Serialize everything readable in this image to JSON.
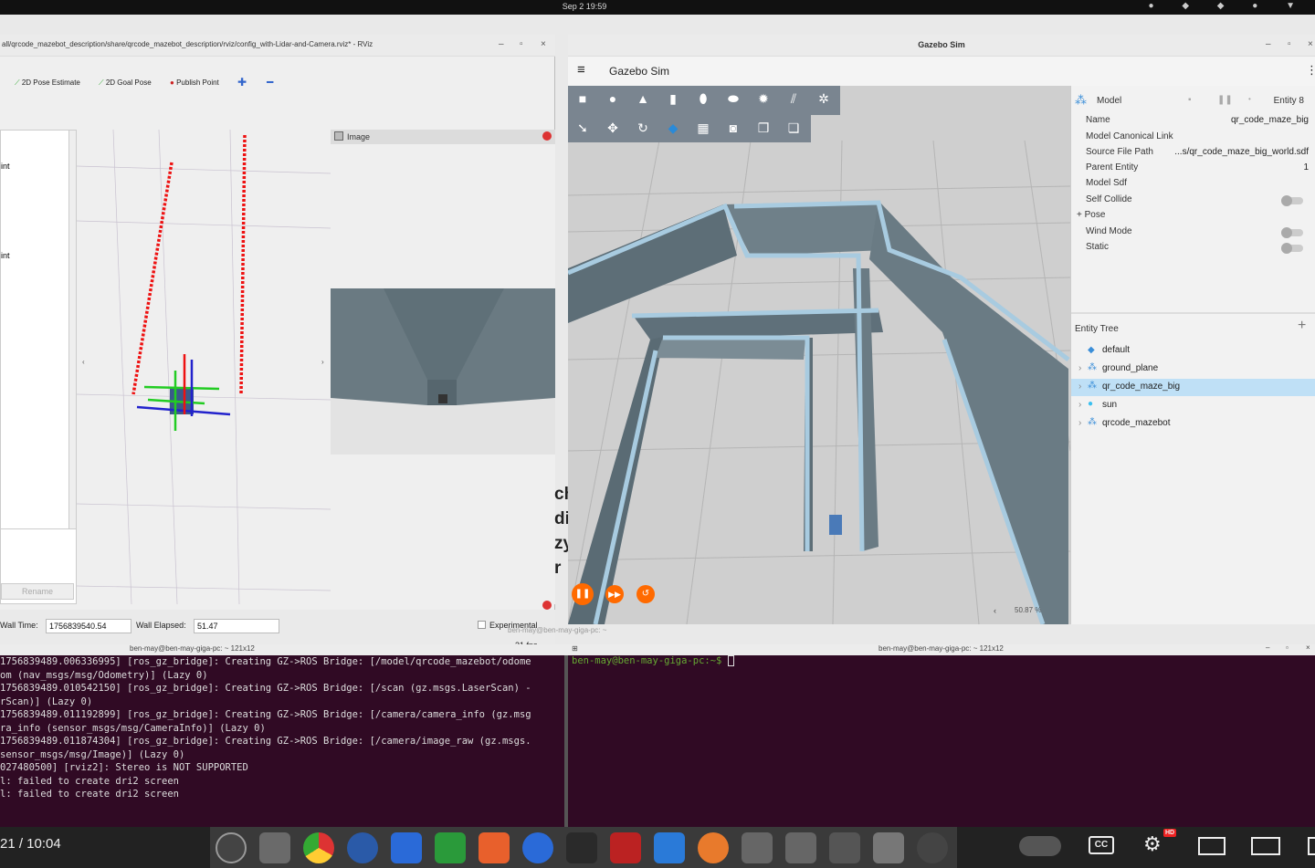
{
  "topbar": {
    "clock": "Sep 2  19:59"
  },
  "rviz": {
    "title": "all/qrcode_mazebot_description/share/qrcode_mazebot_description/rviz/config_with-Lidar-and-Camera.rviz* - RViz",
    "tools": [
      "2D Pose Estimate",
      "2D Goal Pose",
      "Publish Point"
    ],
    "left_items": [
      "int",
      "int"
    ],
    "rename_label": "Rename",
    "image_panel_title": "Image",
    "wall_time_label": "Wall Time:",
    "wall_time": "1756839540.54",
    "wall_elapsed_label": "Wall Elapsed:",
    "wall_elapsed": "51.47",
    "experimental": "Experimental",
    "fps": "31 fps",
    "behind_text": [
      "ch",
      "di",
      "zy",
      "r"
    ]
  },
  "gazebo": {
    "window_title": "Gazebo Sim",
    "app_title": "Gazebo Sim",
    "zoom": "50.87 %",
    "component": {
      "name": "Model",
      "entity": "Entity 8"
    },
    "props": [
      {
        "label": "Name",
        "value": "qr_code_maze_big"
      },
      {
        "label": "Model Canonical Link",
        "value": ""
      },
      {
        "label": "Source File Path",
        "value": "...s/qr_code_maze_big_world.sdf"
      },
      {
        "label": "Parent Entity",
        "value": "1"
      },
      {
        "label": "Model Sdf",
        "value": ""
      }
    ],
    "toggles": [
      "Self Collide"
    ],
    "pose": "+ Pose",
    "toggles2": [
      "Wind Mode",
      "Static"
    ],
    "entity_tree_title": "Entity Tree",
    "tree": [
      "default",
      "ground_plane",
      "qr_code_maze_big",
      "sun",
      "qrcode_mazebot"
    ]
  },
  "terminal": {
    "left_title": "ben-may@ben-may-giga-pc: ~ 121x12",
    "right_title": "ben-may@ben-may-giga-pc: ~ 121x12",
    "center_title": "ben-may@ben-may-giga-pc: ~",
    "lines": [
      "1756839489.006336995] [ros_gz_bridge]: Creating GZ->ROS Bridge: [/model/qrcode_mazebot/odome",
      "om (nav_msgs/msg/Odometry)] (Lazy 0)",
      "1756839489.010542150] [ros_gz_bridge]: Creating GZ->ROS Bridge: [/scan (gz.msgs.LaserScan) -",
      "rScan)] (Lazy 0)",
      "1756839489.011192899] [ros_gz_bridge]: Creating GZ->ROS Bridge: [/camera/camera_info (gz.msg",
      "ra_info (sensor_msgs/msg/CameraInfo)] (Lazy 0)",
      "1756839489.011874304] [ros_gz_bridge]: Creating GZ->ROS Bridge: [/camera/image_raw (gz.msgs.",
      "sensor_msgs/msg/Image)] (Lazy 0)",
      "027480500] [rviz2]: Stereo is NOT SUPPORTED",
      "l: failed to create dri2 screen",
      "l: failed to create dri2 screen"
    ],
    "prompt": "ben-may@ben-may-giga-pc:~$"
  },
  "player": {
    "time": "21 / 10:04",
    "hd": "HD",
    "cc": "CC"
  }
}
